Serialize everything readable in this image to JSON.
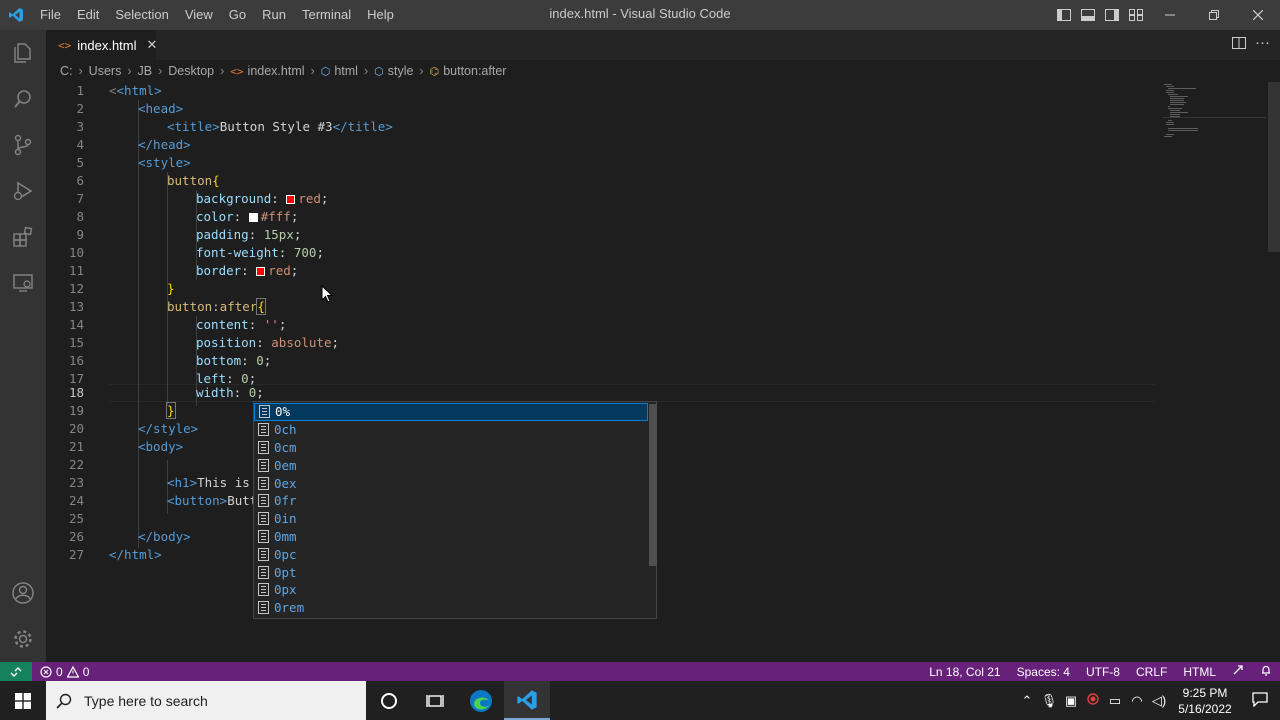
{
  "titlebar": {
    "menu": [
      "File",
      "Edit",
      "Selection",
      "View",
      "Go",
      "Run",
      "Terminal",
      "Help"
    ],
    "title": "index.html - Visual Studio Code"
  },
  "tab": {
    "icon": "<>",
    "label": "index.html",
    "close": "✕"
  },
  "breadcrumb": [
    "C:",
    "Users",
    "JB",
    "Desktop",
    "index.html",
    "html",
    "style",
    "button:after"
  ],
  "editor": {
    "line_numbers": [
      "1",
      "2",
      "3",
      "4",
      "5",
      "6",
      "7",
      "8",
      "9",
      "10",
      "11",
      "12",
      "13",
      "14",
      "15",
      "16",
      "17",
      "18",
      "19",
      "20",
      "21",
      "22",
      "23",
      "24",
      "25",
      "26",
      "27"
    ],
    "active_line": "18",
    "lines": {
      "l1": "<html>",
      "l2": "<head>",
      "l3a": "<title>",
      "l3b": "Button Style #3",
      "l3c": "</title>",
      "l4": "</head>",
      "l5": "<style>",
      "l6": "button",
      "l7k": "background",
      "l7v": "red",
      "l8k": "color",
      "l8v": "#fff",
      "l9k": "padding",
      "l9v": "15px",
      "l10k": "font-weight",
      "l10v": "700",
      "l11k": "border",
      "l11v": "red",
      "l13": "button:after",
      "l14k": "content",
      "l14v": "''",
      "l15k": "position",
      "l15v": "absolute",
      "l16k": "bottom",
      "l16v": "0",
      "l17k": "left",
      "l17v": "0",
      "l18k": "width",
      "l18v": "0",
      "l20": "</style>",
      "l21": "<body>",
      "l23a": "<h1>",
      "l23b": "This is",
      "l24a": "<button>",
      "l24b": "Butt",
      "l26": "</body>",
      "l27": "</html>"
    }
  },
  "suggestions": [
    "0%",
    "0ch",
    "0cm",
    "0em",
    "0ex",
    "0fr",
    "0in",
    "0mm",
    "0pc",
    "0pt",
    "0px",
    "0rem"
  ],
  "colors": {
    "red_swatch": "#ff0000",
    "white_swatch": "#ffffff",
    "statusbar": "#68217a",
    "remote": "#16825d"
  },
  "statusbar": {
    "errors": "0",
    "warnings": "0",
    "cursor_pos": "Ln 18, Col 21",
    "indent": "Spaces: 4",
    "encoding": "UTF-8",
    "eol": "CRLF",
    "language": "HTML"
  },
  "taskbar": {
    "search_placeholder": "Type here to search",
    "time": "9:25 PM",
    "date": "5/16/2022"
  }
}
